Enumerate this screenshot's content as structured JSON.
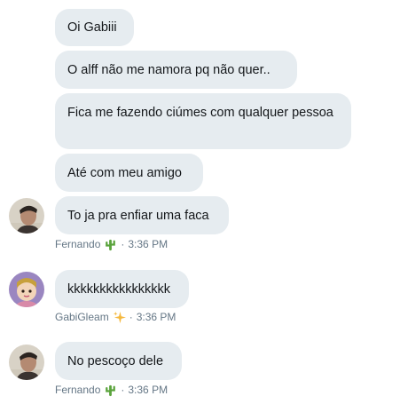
{
  "messages": [
    {
      "text": "Oi Gabiii"
    },
    {
      "text": "O alff não me namora pq  não quer.."
    },
    {
      "text": "Fica me fazendo ciúmes com qualquer pessoa"
    },
    {
      "text": "Até com meu amigo"
    },
    {
      "text": "To ja pra enfiar uma faca"
    },
    {
      "text": "kkkkkkkkkkkkkkkk"
    },
    {
      "text": "No pescoço dele"
    }
  ],
  "meta": [
    {
      "name": "Fernando",
      "emoji_icon": "cactus-icon",
      "separator": "·",
      "time": "3:36 PM"
    },
    {
      "name": "GabiGleam",
      "emoji_icon": "sparkles-icon",
      "separator": "·",
      "time": "3:36 PM"
    },
    {
      "name": "Fernando",
      "emoji_icon": "cactus-icon",
      "separator": "·",
      "time": "3:36 PM"
    }
  ],
  "colors": {
    "bubble": "#e6ecf0",
    "text": "#14171a",
    "meta": "#657786",
    "cactus": "#5aa33c",
    "sparkles": "#f5b83d"
  }
}
